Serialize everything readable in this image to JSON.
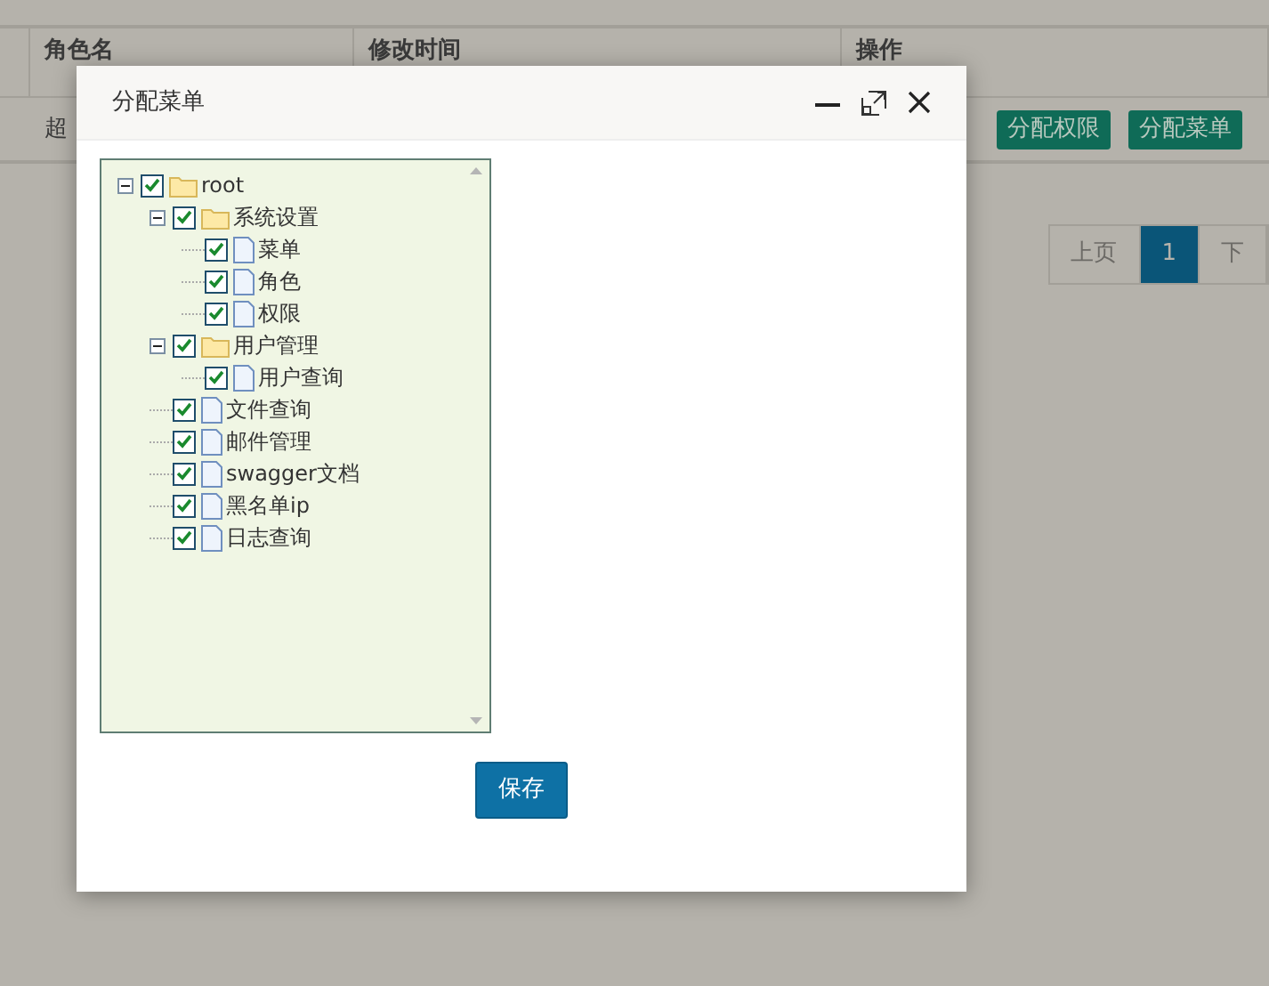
{
  "table": {
    "columns": [
      "角色名",
      "修改时间",
      "操作"
    ],
    "rows": [
      {
        "cells": [
          "超"
        ],
        "actions": [
          "分配权限",
          "分配菜单"
        ]
      }
    ]
  },
  "pagination": [
    {
      "label": "上页",
      "selected": false
    },
    {
      "label": "1",
      "selected": true
    },
    {
      "label": "下",
      "selected": false
    }
  ],
  "dialog": {
    "title": "分配菜单",
    "tree": [
      {
        "label": "root",
        "kind": "folder",
        "checked": true,
        "expanded": true,
        "children": [
          {
            "label": "系统设置",
            "kind": "folder",
            "checked": true,
            "expanded": true,
            "children": [
              {
                "label": "菜单",
                "kind": "file",
                "checked": true
              },
              {
                "label": "角色",
                "kind": "file",
                "checked": true
              },
              {
                "label": "权限",
                "kind": "file",
                "checked": true
              }
            ]
          },
          {
            "label": "用户管理",
            "kind": "folder",
            "checked": true,
            "expanded": true,
            "children": [
              {
                "label": "用户查询",
                "kind": "file",
                "checked": true
              }
            ]
          },
          {
            "label": "文件查询",
            "kind": "file",
            "checked": true
          },
          {
            "label": "邮件管理",
            "kind": "file",
            "checked": true
          },
          {
            "label": "swagger文档",
            "kind": "file",
            "checked": true
          },
          {
            "label": "黑名单ip",
            "kind": "file",
            "checked": true
          },
          {
            "label": "日志查询",
            "kind": "file",
            "checked": true
          }
        ]
      }
    ],
    "save_button": "保存"
  }
}
